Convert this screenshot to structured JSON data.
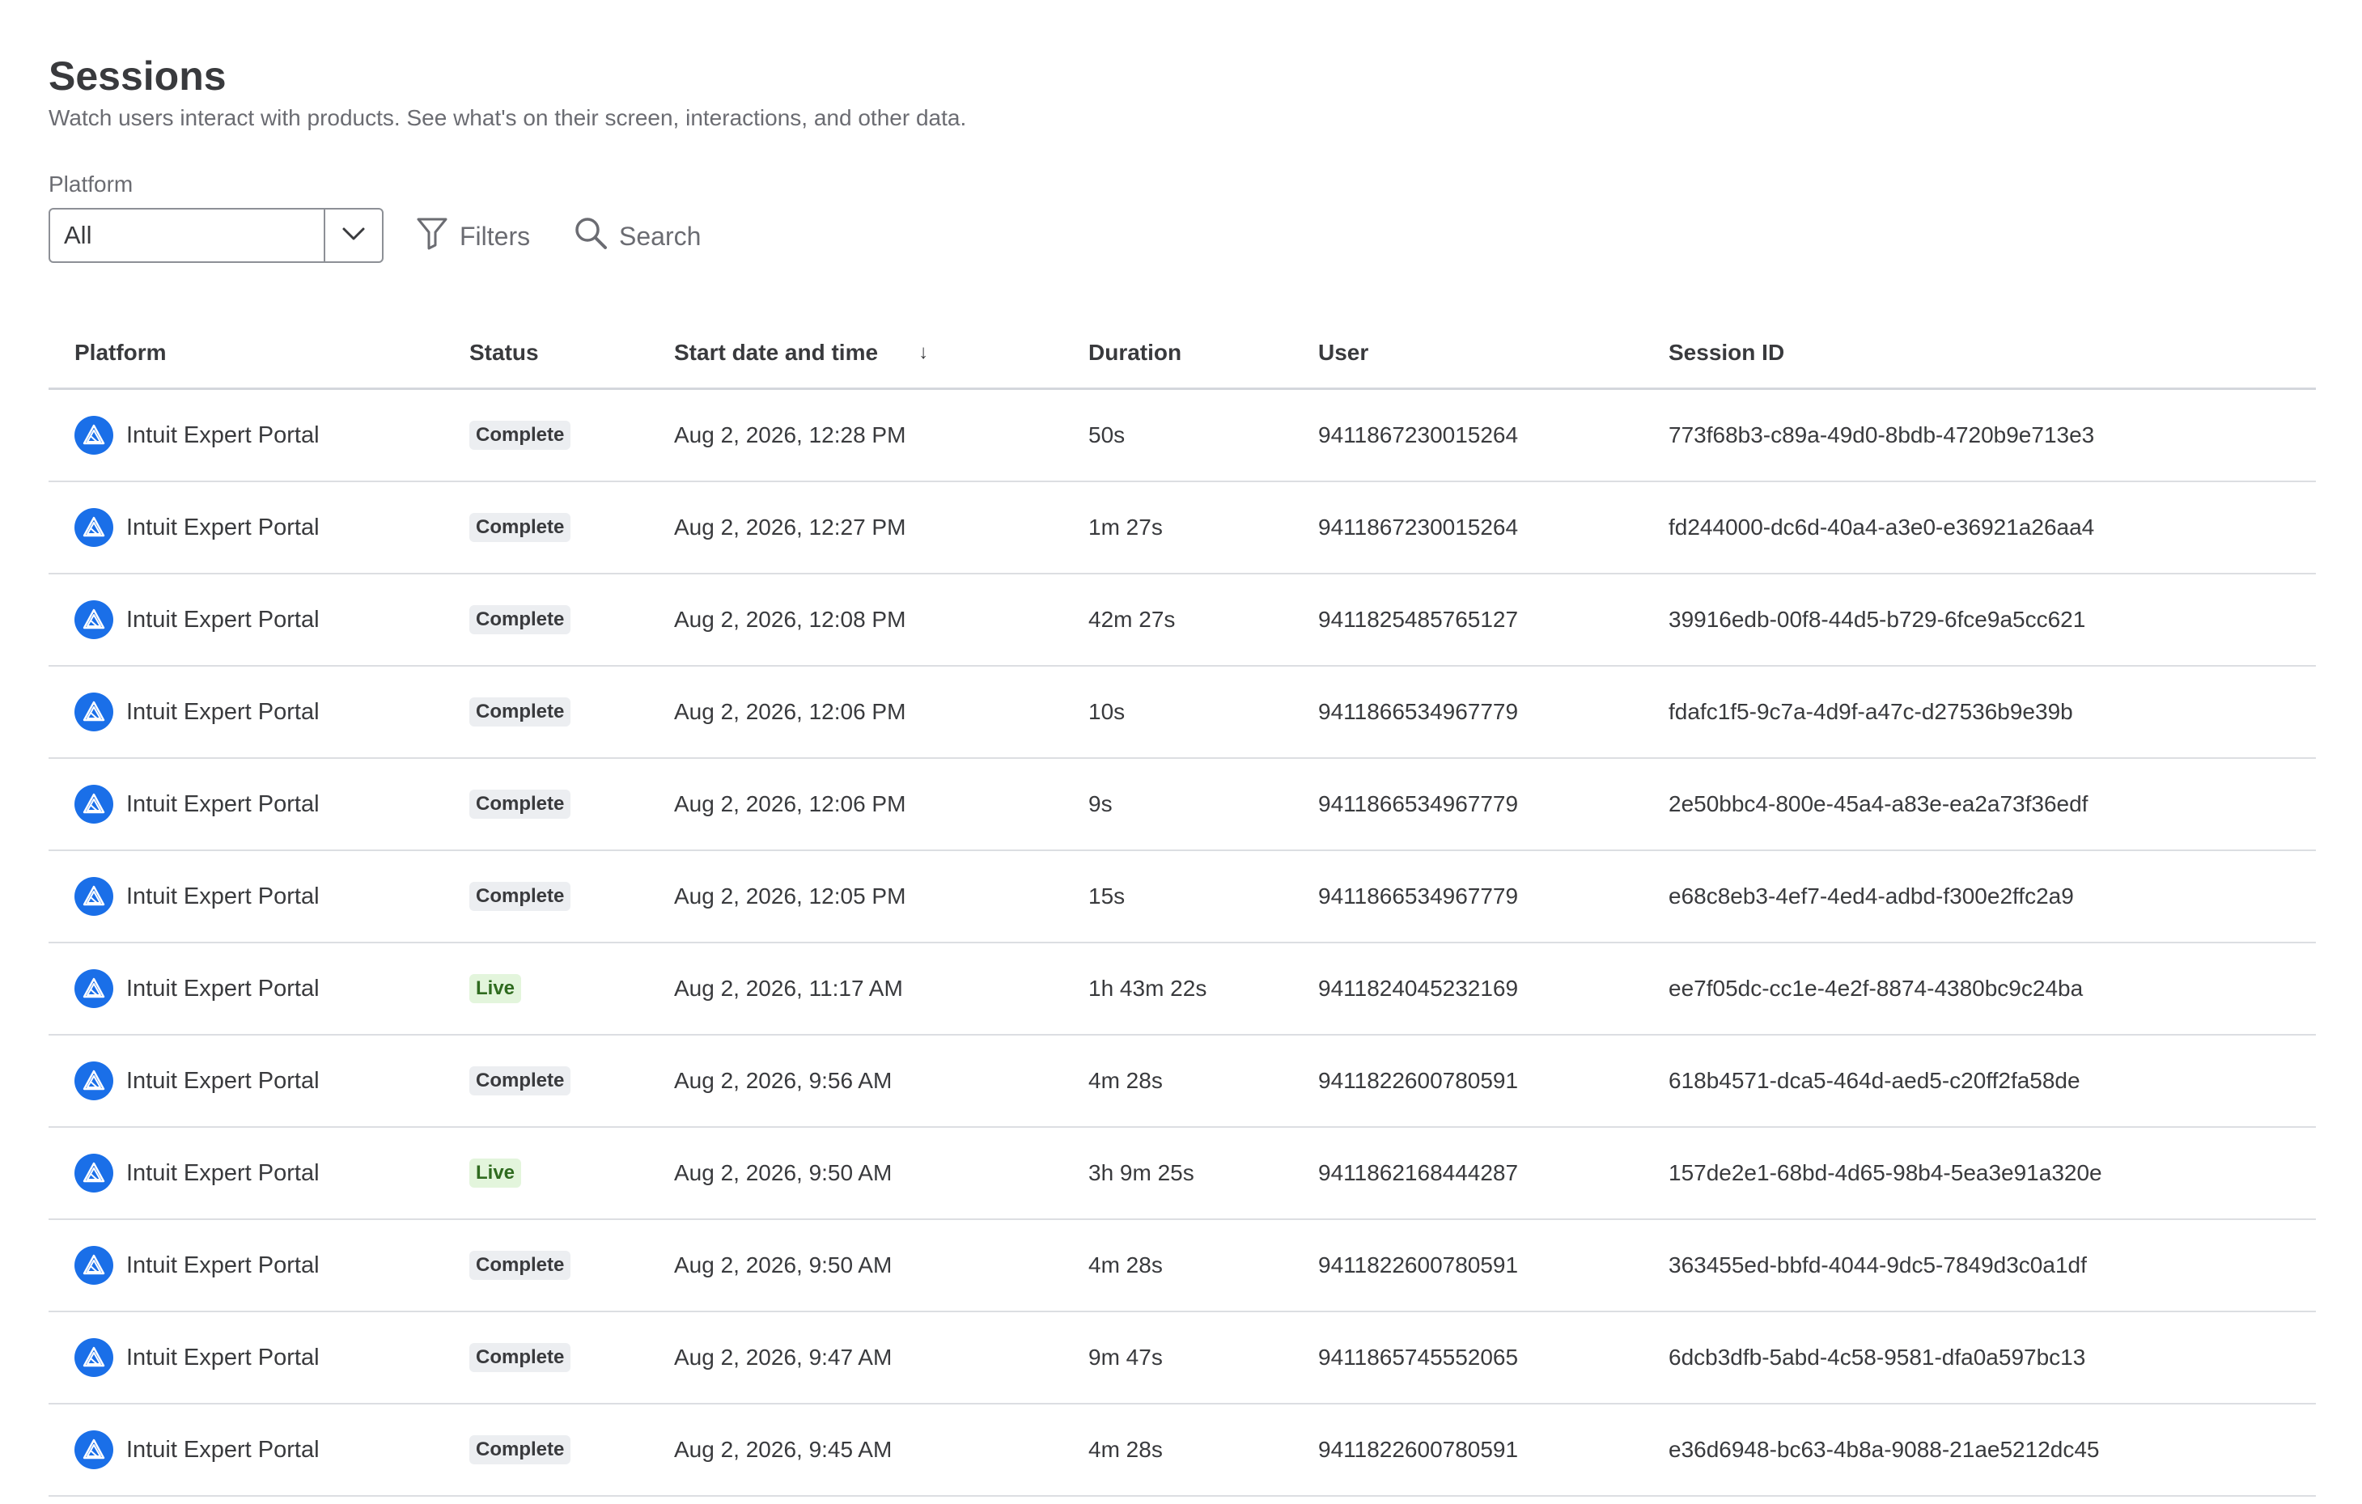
{
  "header": {
    "title": "Sessions",
    "subtitle": "Watch users interact with products. See what's on their screen, interactions, and other data."
  },
  "filters": {
    "platform_label": "Platform",
    "platform_value": "All",
    "filters_label": "Filters",
    "search_label": "Search"
  },
  "table": {
    "columns": {
      "platform": "Platform",
      "status": "Status",
      "start": "Start date and time",
      "start_sort": "↓",
      "duration": "Duration",
      "user": "User",
      "session_id": "Session ID"
    },
    "rows": [
      {
        "platform": "Intuit Expert Portal",
        "status": "Complete",
        "start": "Aug 2, 2026, 12:28 PM",
        "duration": "50s",
        "user": "9411867230015264",
        "session_id": "773f68b3-c89a-49d0-8bdb-4720b9e713e3"
      },
      {
        "platform": "Intuit Expert Portal",
        "status": "Complete",
        "start": "Aug 2, 2026, 12:27 PM",
        "duration": "1m 27s",
        "user": "9411867230015264",
        "session_id": "fd244000-dc6d-40a4-a3e0-e36921a26aa4"
      },
      {
        "platform": "Intuit Expert Portal",
        "status": "Complete",
        "start": "Aug 2, 2026, 12:08 PM",
        "duration": "42m 27s",
        "user": "9411825485765127",
        "session_id": "39916edb-00f8-44d5-b729-6fce9a5cc621"
      },
      {
        "platform": "Intuit Expert Portal",
        "status": "Complete",
        "start": "Aug 2, 2026, 12:06 PM",
        "duration": "10s",
        "user": "9411866534967779",
        "session_id": "fdafc1f5-9c7a-4d9f-a47c-d27536b9e39b"
      },
      {
        "platform": "Intuit Expert Portal",
        "status": "Complete",
        "start": "Aug 2, 2026, 12:06 PM",
        "duration": "9s",
        "user": "9411866534967779",
        "session_id": "2e50bbc4-800e-45a4-a83e-ea2a73f36edf"
      },
      {
        "platform": "Intuit Expert Portal",
        "status": "Complete",
        "start": "Aug 2, 2026, 12:05 PM",
        "duration": "15s",
        "user": "9411866534967779",
        "session_id": "e68c8eb3-4ef7-4ed4-adbd-f300e2ffc2a9"
      },
      {
        "platform": "Intuit Expert Portal",
        "status": "Live",
        "start": "Aug 2, 2026, 11:17 AM",
        "duration": "1h 43m 22s",
        "user": "9411824045232169",
        "session_id": "ee7f05dc-cc1e-4e2f-8874-4380bc9c24ba"
      },
      {
        "platform": "Intuit Expert Portal",
        "status": "Complete",
        "start": "Aug 2, 2026, 9:56 AM",
        "duration": "4m 28s",
        "user": "9411822600780591",
        "session_id": "618b4571-dca5-464d-aed5-c20ff2fa58de"
      },
      {
        "platform": "Intuit Expert Portal",
        "status": "Live",
        "start": "Aug 2, 2026, 9:50 AM",
        "duration": "3h 9m 25s",
        "user": "9411862168444287",
        "session_id": "157de2e1-68bd-4d65-98b4-5ea3e91a320e"
      },
      {
        "platform": "Intuit Expert Portal",
        "status": "Complete",
        "start": "Aug 2, 2026, 9:50 AM",
        "duration": "4m 28s",
        "user": "9411822600780591",
        "session_id": "363455ed-bbfd-4044-9dc5-7849d3c0a1df"
      },
      {
        "platform": "Intuit Expert Portal",
        "status": "Complete",
        "start": "Aug 2, 2026, 9:47 AM",
        "duration": "9m 47s",
        "user": "9411865745552065",
        "session_id": "6dcb3dfb-5abd-4c58-9581-dfa0a597bc13"
      },
      {
        "platform": "Intuit Expert Portal",
        "status": "Complete",
        "start": "Aug 2, 2026, 9:45 AM",
        "duration": "4m 28s",
        "user": "9411822600780591",
        "session_id": "e36d6948-bc63-4b8a-9088-21ae5212dc45"
      }
    ]
  },
  "icons": {
    "platform": "intuit-expert-portal-icon",
    "dropdown": "chevron-down-icon",
    "filters": "filter-funnel-icon",
    "search": "search-icon"
  },
  "colors": {
    "accent": "#1a6fe8",
    "badge_complete_bg": "#eceef1",
    "badge_live_bg": "#e3f5dc",
    "badge_live_text": "#2f6b1f"
  }
}
